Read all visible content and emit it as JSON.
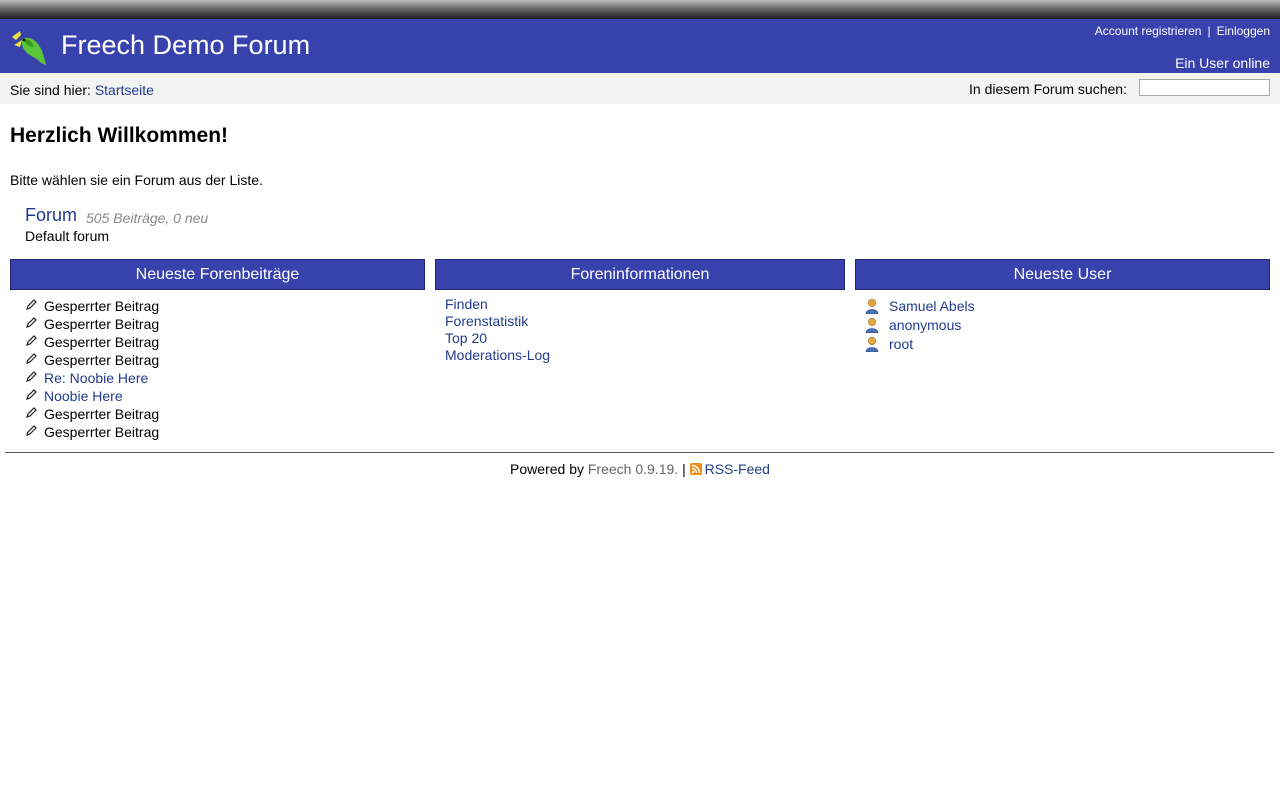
{
  "header": {
    "title": "Freech Demo Forum",
    "logo_icon": "bird-logo-icon",
    "register_label": "Account registrieren",
    "separator": "|",
    "login_label": "Einloggen",
    "online_text": "Ein User online",
    "background": "#3842ad"
  },
  "breadcrumb": {
    "prefix": "Sie sind hier:",
    "home": "Startseite"
  },
  "search": {
    "label": "In diesem Forum suchen:",
    "value": "",
    "placeholder": ""
  },
  "main": {
    "heading": "Herzlich Willkommen!",
    "intro": "Bitte wählen sie ein Forum aus der Liste.",
    "forum": {
      "name": "Forum",
      "meta": "505 Beiträge, 0 neu",
      "description": "Default forum"
    }
  },
  "boxes": {
    "posts": {
      "title": "Neueste Forenbeiträge",
      "icon": "pencil-icon",
      "items": [
        {
          "label": "Gesperrter Beitrag",
          "link": false
        },
        {
          "label": "Gesperrter Beitrag",
          "link": false
        },
        {
          "label": "Gesperrter Beitrag",
          "link": false
        },
        {
          "label": "Gesperrter Beitrag",
          "link": false
        },
        {
          "label": "Re: Noobie Here",
          "link": true
        },
        {
          "label": "Noobie Here",
          "link": true
        },
        {
          "label": "Gesperrter Beitrag",
          "link": false
        },
        {
          "label": "Gesperrter Beitrag",
          "link": false
        }
      ]
    },
    "info": {
      "title": "Foreninformationen",
      "items": [
        "Finden",
        "Forenstatistik",
        "Top 20",
        "Moderations-Log"
      ]
    },
    "users": {
      "title": "Neueste User",
      "icon": "user-icon",
      "items": [
        "Samuel Abels",
        "anonymous",
        "root"
      ]
    }
  },
  "footer": {
    "powered_by": "Powered by",
    "product": "Freech",
    "version": "0.9.19.",
    "separator": "|",
    "rss_label": "RSS-Feed",
    "rss_icon": "rss-icon"
  },
  "colors": {
    "accent": "#3842ad",
    "link": "#233b8c",
    "muted": "#888888"
  }
}
